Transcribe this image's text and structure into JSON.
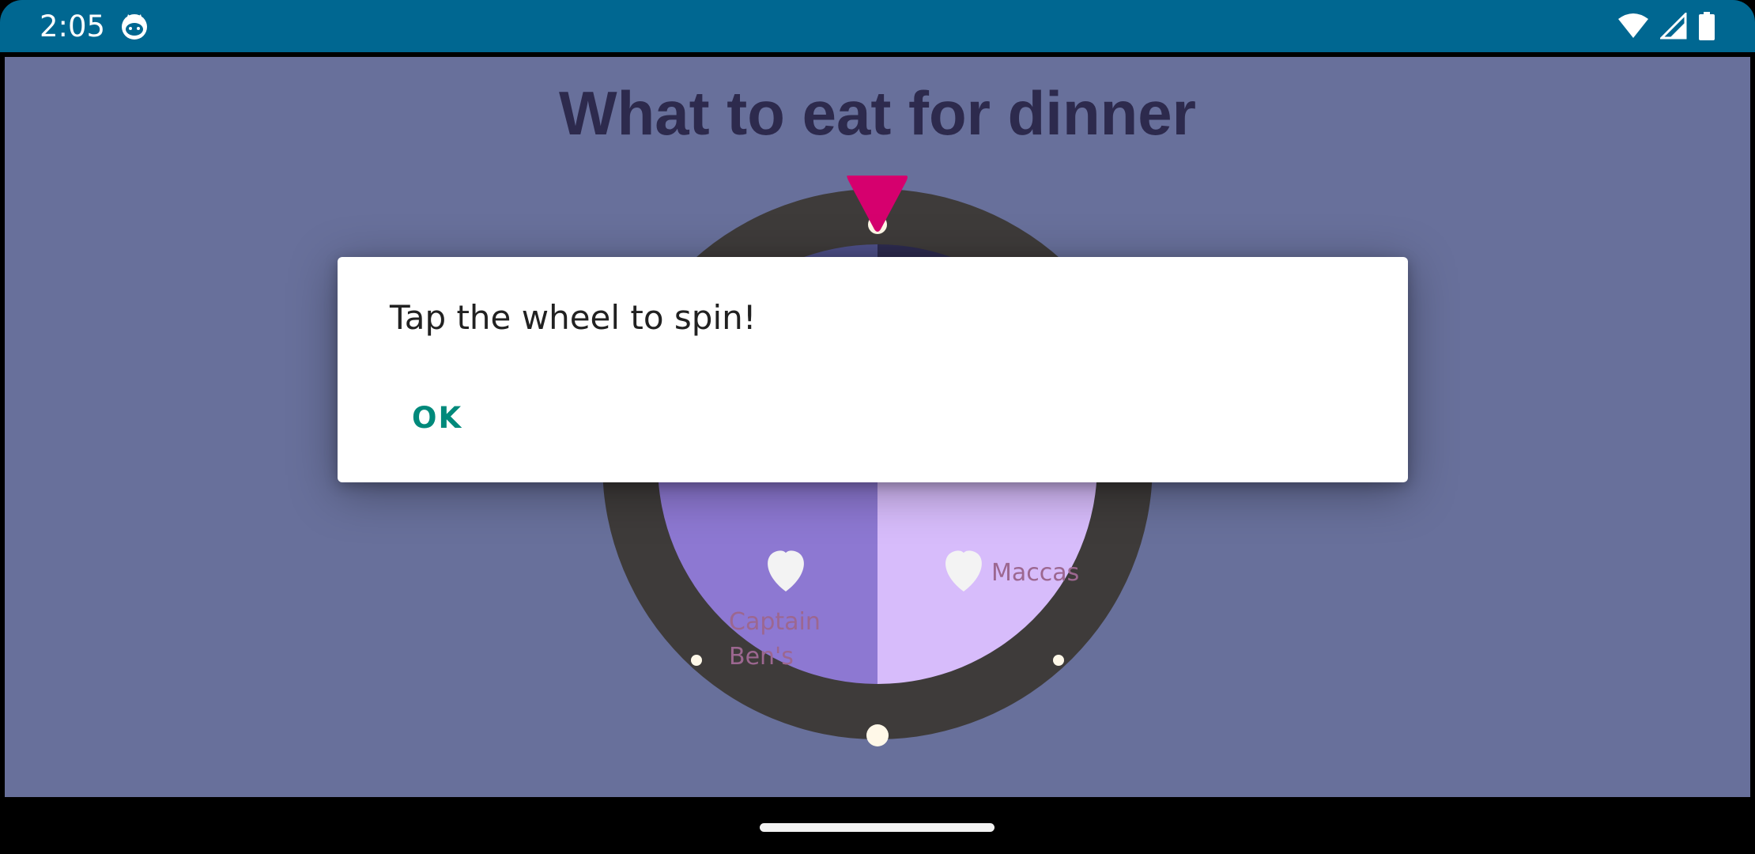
{
  "status_bar": {
    "time": "2:05",
    "app_icon": "cat-face-icon",
    "icons": [
      "wifi-icon",
      "cell-signal-icon",
      "battery-icon"
    ]
  },
  "app": {
    "title": "What to eat for dinner",
    "background_color": "#68709b",
    "wheel": {
      "pointer_color": "#d6006e",
      "rim_color": "#3e3b3a",
      "segments": [
        {
          "color": "#4e5089"
        },
        {
          "color": "#2d2b4f"
        },
        {
          "label": "Maccas",
          "color": "#d7bcfb",
          "favorite_icon": "heart-icon"
        },
        {
          "label": "Captain Ben's",
          "label_line1": "Captain",
          "label_line2": "Ben's",
          "color": "#8d78d2",
          "favorite_icon": "heart-icon"
        }
      ]
    }
  },
  "dialog": {
    "message": "Tap the wheel to spin!",
    "ok_label": "OK",
    "ok_color": "#00897b"
  },
  "nav_bar": {
    "handle": "home-handle"
  }
}
